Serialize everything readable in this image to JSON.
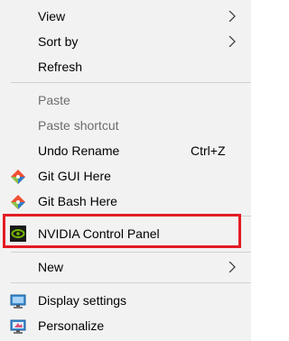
{
  "context_menu": {
    "items": [
      {
        "label": "View",
        "has_submenu": true
      },
      {
        "label": "Sort by",
        "has_submenu": true
      },
      {
        "label": "Refresh"
      },
      {
        "label": "Paste",
        "disabled": true
      },
      {
        "label": "Paste shortcut",
        "disabled": true
      },
      {
        "label": "Undo Rename",
        "shortcut": "Ctrl+Z"
      },
      {
        "label": "Git GUI Here",
        "icon": "git-gui-icon"
      },
      {
        "label": "Git Bash Here",
        "icon": "git-bash-icon"
      },
      {
        "label": "NVIDIA Control Panel",
        "icon": "nvidia-icon",
        "highlighted": true
      },
      {
        "label": "New",
        "has_submenu": true
      },
      {
        "label": "Display settings",
        "icon": "display-settings-icon"
      },
      {
        "label": "Personalize",
        "icon": "personalize-icon"
      }
    ]
  },
  "colors": {
    "menu_background": "#f2f2f2",
    "disabled_text": "#6d6d6d",
    "separator": "#d0d0d0",
    "highlight_border": "#e31c24",
    "nvidia_green": "#76b900"
  }
}
